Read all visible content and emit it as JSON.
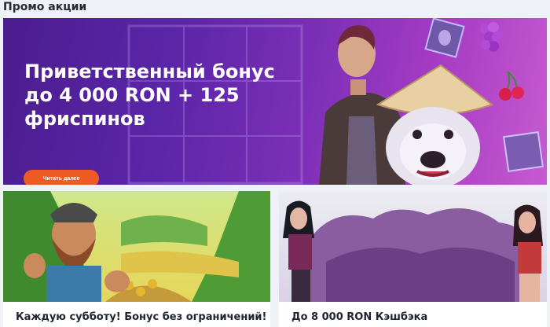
{
  "section": {
    "title": "Промо акции"
  },
  "hero": {
    "title_line1": "Приветственный бонус",
    "title_line2": "до 4 000 RON + 125",
    "title_line3": "фриспинов",
    "button_label": "Читать далее"
  },
  "cards": [
    {
      "title": "Каждую субботу! Бонус без ограничений!"
    },
    {
      "title": "До 8 000 RON Кэшбэка"
    }
  ],
  "colors": {
    "accent": "#ee5a24",
    "hero_bg": "#5a25a8",
    "page_bg": "#eef1f6"
  }
}
